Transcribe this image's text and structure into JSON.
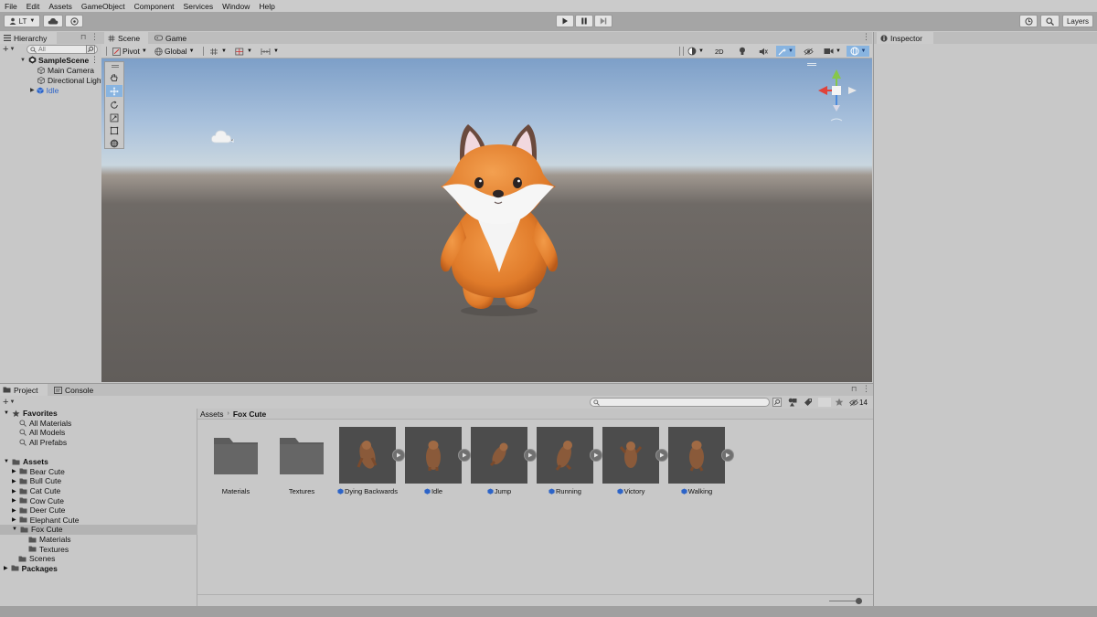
{
  "menu": [
    "File",
    "Edit",
    "Assets",
    "GameObject",
    "Component",
    "Services",
    "Window",
    "Help"
  ],
  "toolbar": {
    "account_label": "LT",
    "layers_label": "Layers"
  },
  "hierarchy": {
    "tab_label": "Hierarchy",
    "search_placeholder": "All",
    "scene_name": "SampleScene",
    "items": [
      "Main Camera",
      "Directional Light",
      "Idle"
    ]
  },
  "scene": {
    "tabs": [
      "Scene",
      "Game"
    ],
    "pivot_label": "Pivot",
    "global_label": "Global",
    "mode_2d": "2D"
  },
  "inspector": {
    "tab_label": "Inspector"
  },
  "project": {
    "tabs": [
      "Project",
      "Console"
    ],
    "hidden_count": "14",
    "favorites_label": "Favorites",
    "favorites": [
      "All Materials",
      "All Models",
      "All Prefabs"
    ],
    "assets_label": "Assets",
    "asset_folders": [
      "Bear Cute",
      "Bull Cute",
      "Cat Cute",
      "Cow Cute",
      "Deer Cute",
      "Elephant Cute",
      "Fox Cute"
    ],
    "fox_children": [
      "Materials",
      "Textures"
    ],
    "scenes_label": "Scenes",
    "packages_label": "Packages",
    "breadcrumb": [
      "Assets",
      "Fox Cute"
    ],
    "grid_items": [
      "Materials",
      "Textures",
      "Dying Backwards",
      "Idle",
      "Jump",
      "Running",
      "Victory",
      "Walking"
    ]
  },
  "colors": {
    "selection_blue": "#3a72b0",
    "prefab_blue": "#2d64c8",
    "fox_orange": "#e07b2a"
  }
}
